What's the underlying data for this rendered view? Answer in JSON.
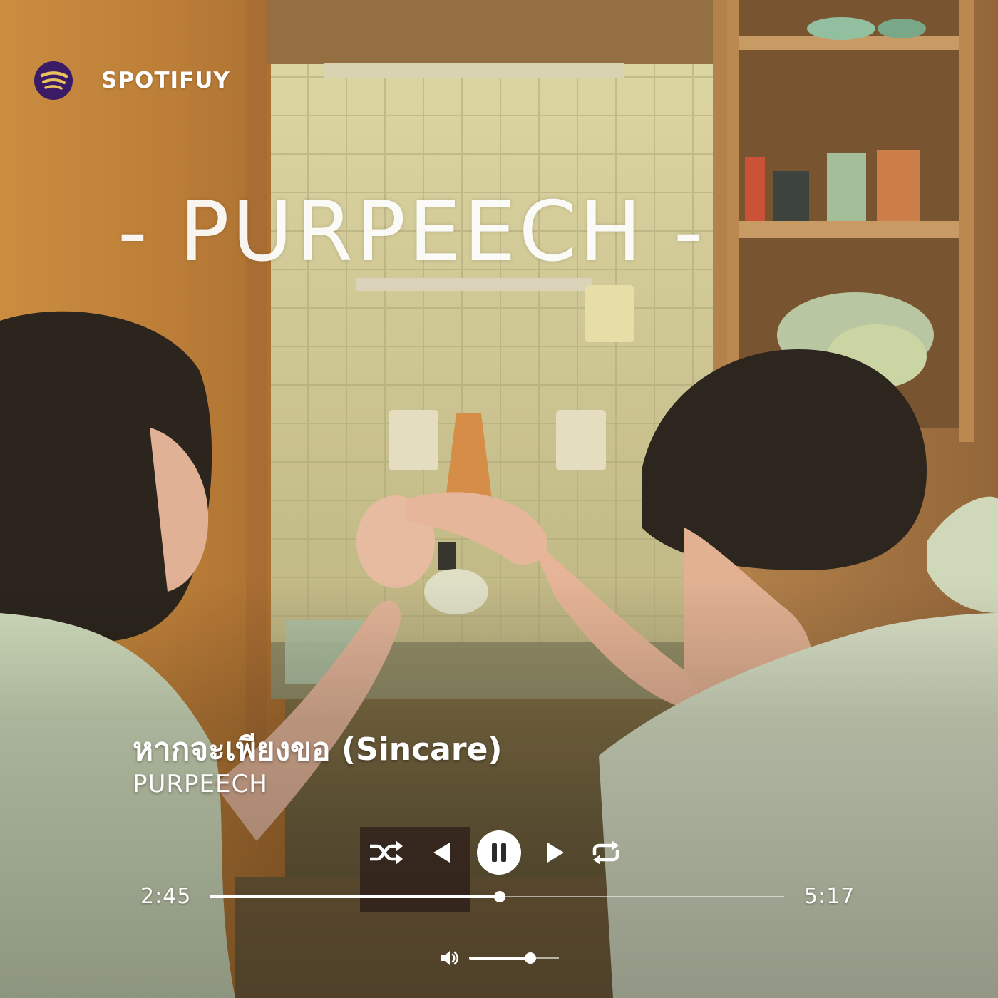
{
  "app": {
    "brand_name": "SPOTIFUY",
    "brand_icon": "spotify-logo-icon",
    "brand_color": "#3b1a66"
  },
  "artwork": {
    "overlay_text": "- PURPEECH -"
  },
  "track": {
    "title": "หากจะเพียงขอ (Sincare)",
    "artist": "PURPEECH"
  },
  "controls": {
    "shuffle_icon": "shuffle-icon",
    "previous_icon": "previous-icon",
    "play_state": "playing",
    "pause_icon": "pause-icon",
    "next_icon": "next-icon",
    "repeat_icon": "repeat-icon"
  },
  "progress": {
    "elapsed": "2:45",
    "total": "5:17",
    "fraction": 0.505
  },
  "volume": {
    "icon": "volume-icon",
    "level": 0.68
  }
}
